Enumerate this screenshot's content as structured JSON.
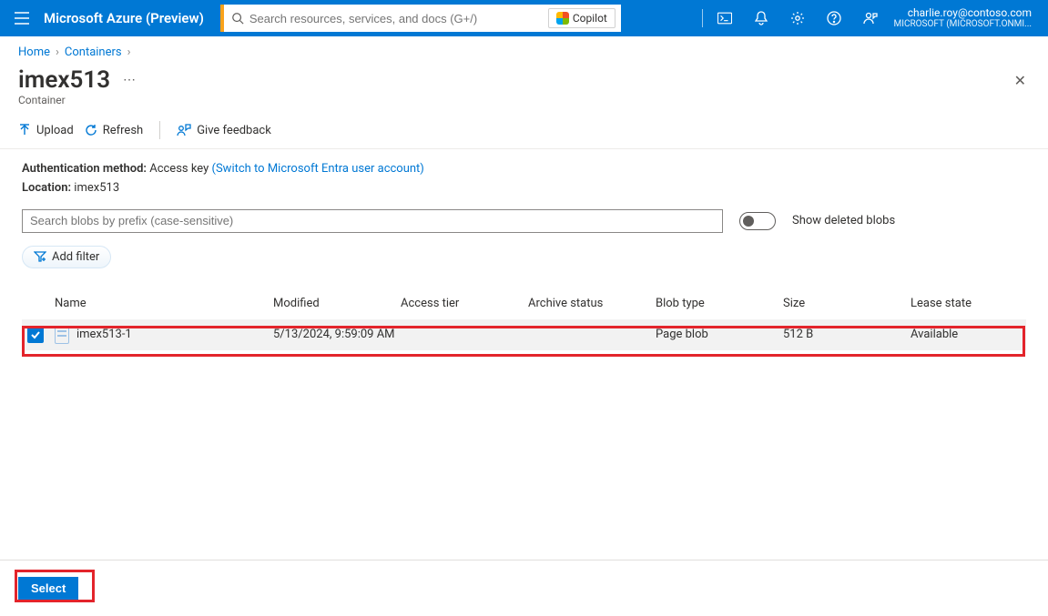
{
  "header": {
    "brand": "Microsoft Azure (Preview)",
    "search_placeholder": "Search resources, services, and docs (G+/)",
    "copilot_label": "Copilot",
    "user_email": "charlie.roy@contoso.com",
    "tenant": "MICROSOFT (MICROSOFT.ONMI..."
  },
  "breadcrumbs": [
    "Home",
    "Containers"
  ],
  "page": {
    "title": "imex513",
    "subtitle": "Container"
  },
  "toolbar": {
    "upload": "Upload",
    "refresh": "Refresh",
    "feedback": "Give feedback"
  },
  "info": {
    "auth_label": "Authentication method:",
    "auth_value": "Access key",
    "auth_link": "(Switch to Microsoft Entra user account)",
    "loc_label": "Location:",
    "loc_value": "imex513"
  },
  "filters": {
    "blob_search_placeholder": "Search blobs by prefix (case-sensitive)",
    "show_deleted_label": "Show deleted blobs",
    "add_filter_label": "Add filter"
  },
  "table": {
    "columns": [
      "Name",
      "Modified",
      "Access tier",
      "Archive status",
      "Blob type",
      "Size",
      "Lease state"
    ],
    "rows": [
      {
        "selected": true,
        "name": "imex513-1",
        "modified": "5/13/2024, 9:59:09 AM",
        "access_tier": "",
        "archive_status": "",
        "blob_type": "Page blob",
        "size": "512 B",
        "lease_state": "Available"
      }
    ]
  },
  "footer": {
    "select_label": "Select"
  }
}
